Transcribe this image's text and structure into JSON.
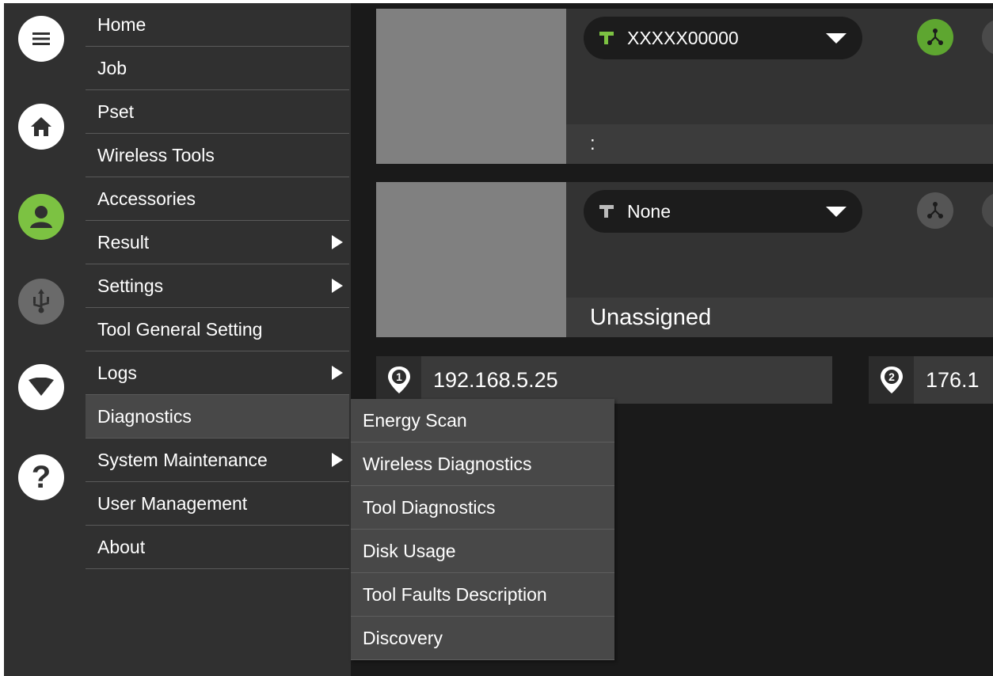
{
  "rail": {
    "items": [
      {
        "name": "menu-icon"
      },
      {
        "name": "home-icon"
      },
      {
        "name": "user-icon"
      },
      {
        "name": "usb-icon"
      },
      {
        "name": "wifi-icon"
      },
      {
        "name": "help-icon"
      }
    ]
  },
  "menu": {
    "items": [
      {
        "label": "Home",
        "has_submenu": false
      },
      {
        "label": "Job",
        "has_submenu": false
      },
      {
        "label": "Pset",
        "has_submenu": false
      },
      {
        "label": "Wireless Tools",
        "has_submenu": false
      },
      {
        "label": "Accessories",
        "has_submenu": false
      },
      {
        "label": "Result",
        "has_submenu": true
      },
      {
        "label": "Settings",
        "has_submenu": true
      },
      {
        "label": "Tool General Setting",
        "has_submenu": false
      },
      {
        "label": "Logs",
        "has_submenu": true
      },
      {
        "label": "Diagnostics",
        "has_submenu": false,
        "active": true
      },
      {
        "label": "System Maintenance",
        "has_submenu": true
      },
      {
        "label": "User Management",
        "has_submenu": false
      },
      {
        "label": "About",
        "has_submenu": false
      }
    ]
  },
  "submenu": {
    "items": [
      {
        "label": "Energy Scan"
      },
      {
        "label": "Wireless Diagnostics"
      },
      {
        "label": "Tool Diagnostics"
      },
      {
        "label": "Disk Usage"
      },
      {
        "label": "Tool Faults Description"
      },
      {
        "label": "Discovery"
      }
    ]
  },
  "cards": [
    {
      "tool_name": "XXXXX00000",
      "status_text": ":",
      "tool_icon_color": "#7cc242",
      "network_color": "#5ea630"
    },
    {
      "tool_name": "None",
      "status_text": "Unassigned",
      "tool_icon_color": "#bbbbbb",
      "network_color": "#555555"
    }
  ],
  "ip": {
    "primary": {
      "badge": "1",
      "address": "192.168.5.25"
    },
    "secondary": {
      "badge": "2",
      "address": "176.1"
    }
  },
  "colors": {
    "accent_green": "#7cc242",
    "menu_bg": "#303030",
    "submenu_bg": "#484848",
    "content_bg": "#1a1a1a"
  }
}
